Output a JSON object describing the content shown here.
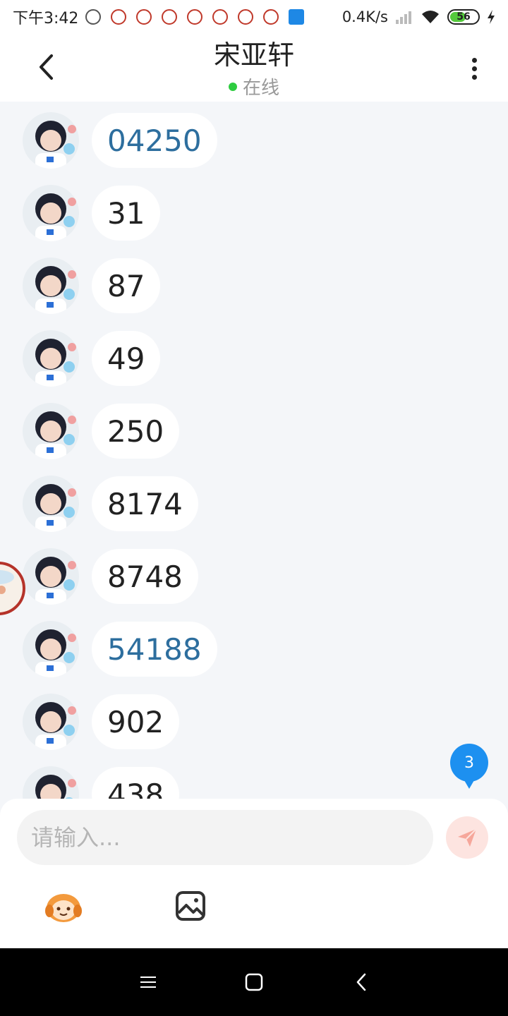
{
  "status_bar": {
    "time": "下午3:42",
    "net_speed": "0.4K/s",
    "battery": "56"
  },
  "header": {
    "title": "宋亚轩",
    "status": "在线"
  },
  "messages": [
    {
      "text": "04250",
      "link": true
    },
    {
      "text": "31",
      "link": false
    },
    {
      "text": "87",
      "link": false
    },
    {
      "text": "49",
      "link": false
    },
    {
      "text": "250",
      "link": false
    },
    {
      "text": "8174",
      "link": false
    },
    {
      "text": "8748",
      "link": false
    },
    {
      "text": "54188",
      "link": true
    },
    {
      "text": "902",
      "link": false
    },
    {
      "text": "438",
      "link": false
    }
  ],
  "unread_count": "3",
  "composer": {
    "placeholder": "请输入..."
  },
  "colors": {
    "online": "#2ecc40",
    "link_text": "#2d6e9e",
    "badge": "#1d90f0",
    "send_bg": "#fde4e0",
    "send_icon": "#f6a79b"
  },
  "icons": [
    "back-icon",
    "more-icon",
    "send-icon",
    "emoji-icon",
    "image-icon",
    "menu-icon",
    "home-icon",
    "nav-back-icon"
  ]
}
